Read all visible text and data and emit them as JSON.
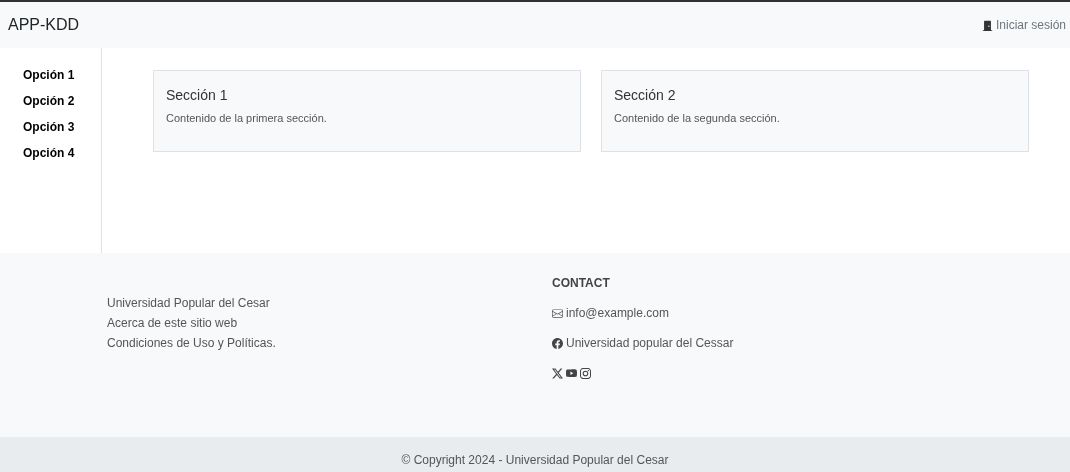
{
  "navbar": {
    "brand": "APP-KDD",
    "login": "Iniciar sesión"
  },
  "sidebar": {
    "items": [
      {
        "label": "Opción 1"
      },
      {
        "label": "Opción 2"
      },
      {
        "label": "Opción 3"
      },
      {
        "label": "Opción 4"
      }
    ]
  },
  "sections": [
    {
      "title": "Sección 1",
      "text": "Contenido de la primera sección."
    },
    {
      "title": "Sección 2",
      "text": "Contenido de la segunda sección."
    }
  ],
  "footer": {
    "links": [
      "Universidad Popular del Cesar",
      "Acerca de este sitio web",
      "Condiciones de Uso y Políticas."
    ],
    "contact": {
      "heading": "CONTACT",
      "email": "info@example.com",
      "facebook": "Universidad popular del Cessar"
    },
    "copyright": "© Copyright 2024 - Universidad Popular del Cesar"
  }
}
